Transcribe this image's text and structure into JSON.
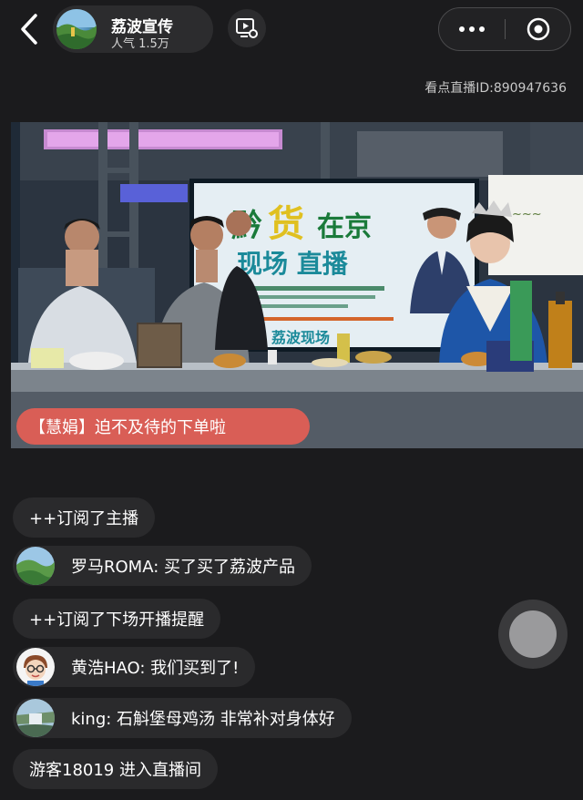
{
  "header": {
    "host_name": "荔波宣传",
    "popularity": "人气 1.5万",
    "live_id": "看点直播ID:890947636"
  },
  "video": {
    "overlay_message": "【慧娟】迫不及待的下单啦",
    "screen_title_1": "黔",
    "screen_title_2": "货",
    "screen_title_3": "在京",
    "screen_title_4": "现场 直播",
    "screen_brand": "荔波现场"
  },
  "chat": [
    {
      "kind": "notice",
      "text": "++订阅了主播"
    },
    {
      "kind": "user",
      "avatar": "landscape-avatar",
      "text": "罗马ROMA: 买了买了荔波产品"
    },
    {
      "kind": "notice",
      "text": "++订阅了下场开播提醒"
    },
    {
      "kind": "user",
      "avatar": "cartoon-glasses-avatar",
      "text": "黄浩HAO: 我们买到了!"
    },
    {
      "kind": "user",
      "avatar": "waterfall-avatar",
      "text": "king: 石斛堡母鸡汤 非常补对身体好"
    },
    {
      "kind": "notice",
      "text": "游客18019 进入直播间"
    }
  ],
  "colors": {
    "background": "#1b1b1d",
    "pill": "#2a2a2c",
    "overlay": "#ec5e54"
  }
}
